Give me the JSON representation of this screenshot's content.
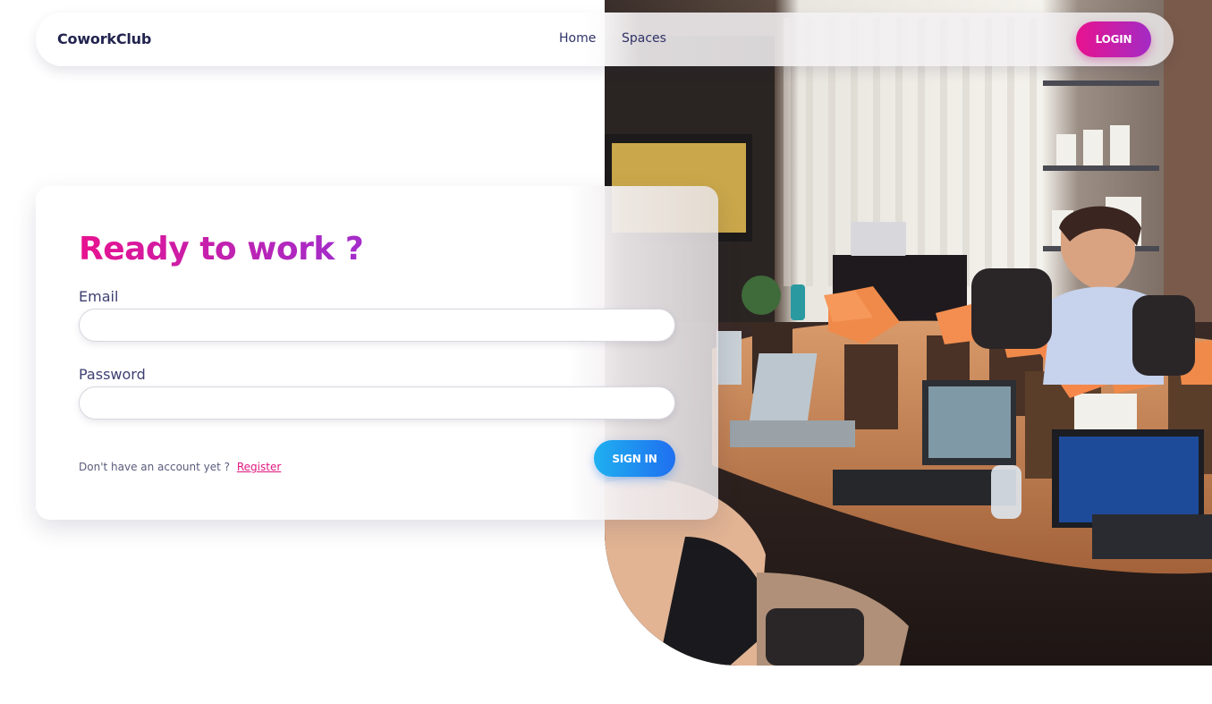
{
  "navbar": {
    "brand": "CoworkClub",
    "links": [
      {
        "label": "Home"
      },
      {
        "label": "Spaces"
      }
    ],
    "login_label": "LOGIN"
  },
  "login_form": {
    "title": "Ready to work ?",
    "email_label": "Email",
    "email_value": "",
    "password_label": "Password",
    "password_value": "",
    "no_account_text": "Don't have an account yet ?",
    "register_label": "Register",
    "signin_label": "SIGN IN"
  },
  "colors": {
    "brand_gradient_start": "#e8128f",
    "brand_gradient_end": "#a52cc8",
    "signin_gradient_start": "#1fb0f0",
    "signin_gradient_end": "#1f6ff0",
    "text_dark": "#22244f"
  },
  "hero": {
    "icon": "office-meeting-photo"
  }
}
